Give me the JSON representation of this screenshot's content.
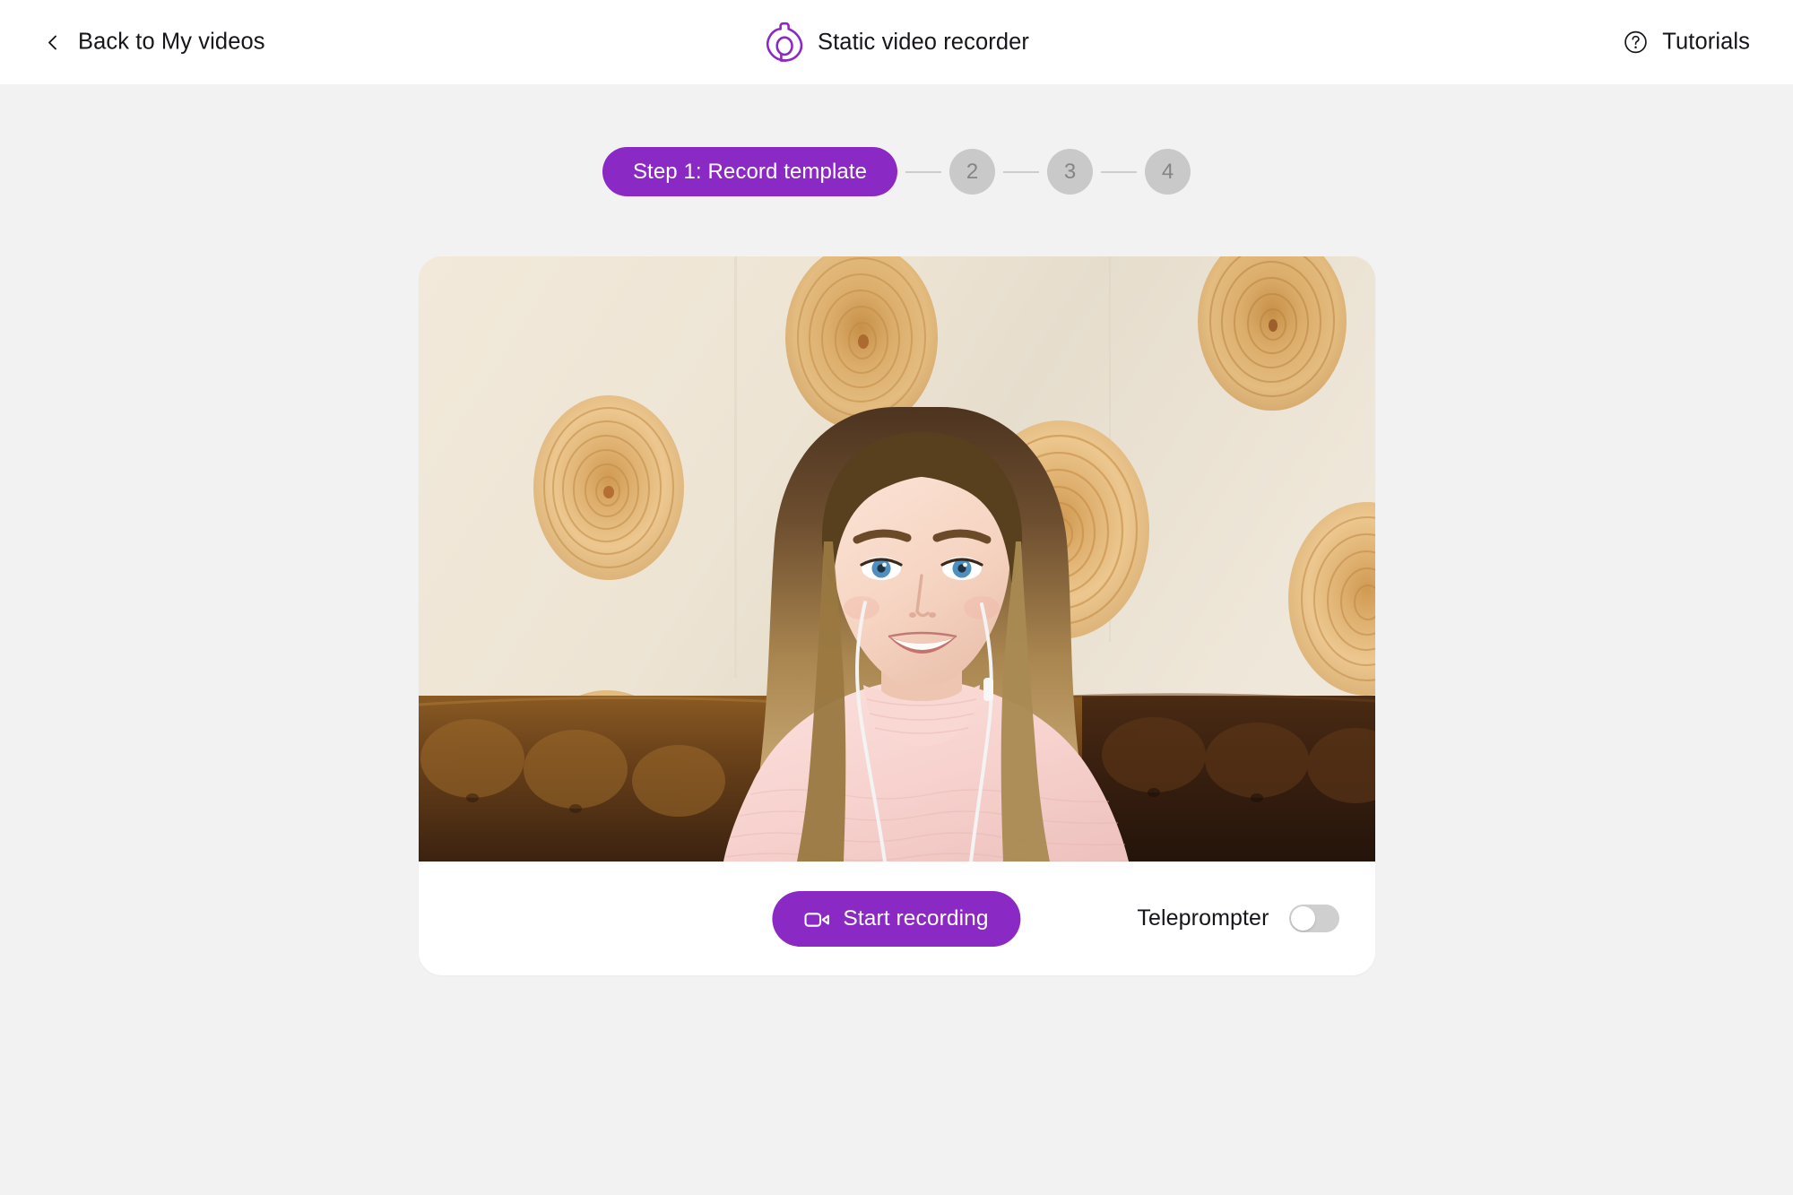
{
  "header": {
    "back_label": "Back to My videos",
    "back_icon": "chevron-left-icon",
    "brand_icon": "app-logo-icon",
    "brand_title": "Static video recorder",
    "tutorials_label": "Tutorials",
    "tutorials_icon": "question-circle-icon"
  },
  "stepper": {
    "current_step_label": "Step 1: Record template",
    "steps": [
      {
        "number": "2",
        "active": false
      },
      {
        "number": "3",
        "active": false
      },
      {
        "number": "4",
        "active": false
      }
    ]
  },
  "recorder": {
    "preview_alt": "Webcam preview: smiling woman with long blonde hair, blue eyes, wearing a pink knit sweater and white earbuds, seated on a brown tufted leather sofa in front of a cream wall decorated with round wooden tree-ring discs",
    "start_button_label": "Start recording",
    "start_button_icon": "video-camera-icon",
    "teleprompter_label": "Teleprompter",
    "teleprompter_on": false
  },
  "colors": {
    "accent_purple": "#8a29c4",
    "page_background": "#f2f2f2",
    "card_background": "#ffffff",
    "step_inactive": "#c9c9c9",
    "step_inactive_text": "#858585",
    "toggle_track_off": "#cfcfcf",
    "text_primary": "#15161a"
  }
}
